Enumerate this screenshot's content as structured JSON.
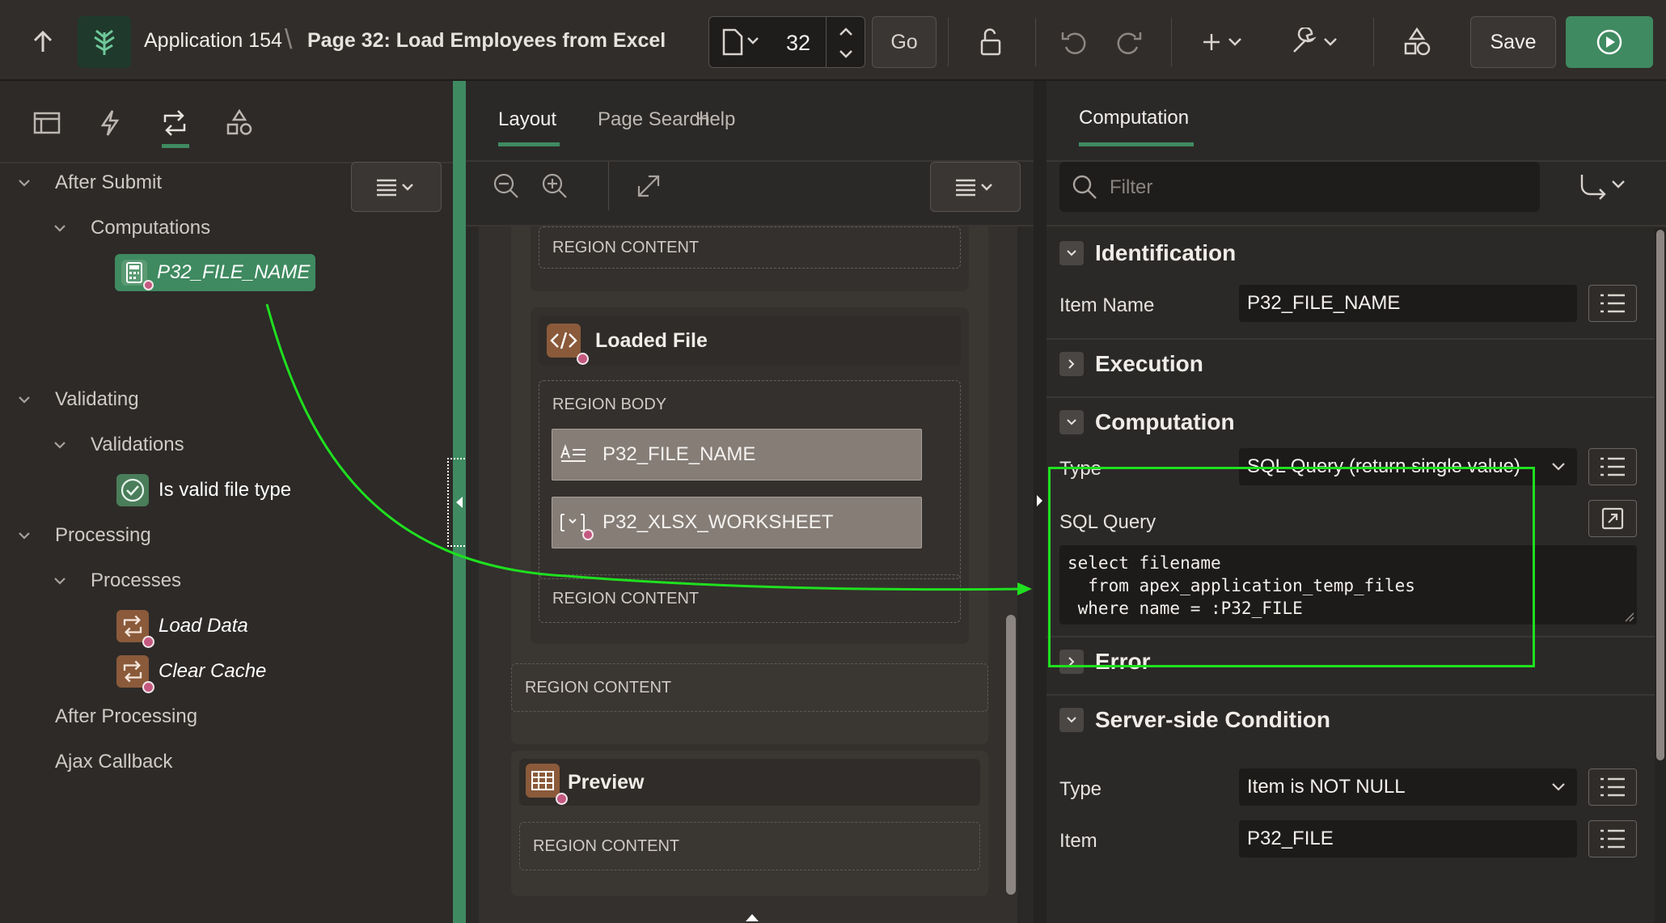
{
  "header": {
    "app_title": "Application 154",
    "page_title": "Page 32: Load Employees from Excel",
    "page_number": "32",
    "go_label": "Go",
    "save_label": "Save"
  },
  "left": {
    "tree": {
      "after_submit": "After Submit",
      "computations": "Computations",
      "computation_item": "P32_FILE_NAME",
      "validating": "Validating",
      "validations": "Validations",
      "validation_item": "Is valid file type",
      "processing": "Processing",
      "processes": "Processes",
      "process_load": "Load Data",
      "process_clear": "Clear Cache",
      "after_processing": "After Processing",
      "ajax_callback": "Ajax Callback"
    }
  },
  "center": {
    "tabs": [
      "Layout",
      "Page Search",
      "Help"
    ],
    "region_content": "REGION CONTENT",
    "region_body": "REGION BODY",
    "loaded_file": "Loaded File",
    "item_file_name": "P32_FILE_NAME",
    "item_worksheet": "P32_XLSX_WORKSHEET",
    "preview": "Preview"
  },
  "right": {
    "tab": "Computation",
    "filter_placeholder": "Filter",
    "sections": {
      "identification": "Identification",
      "execution": "Execution",
      "computation": "Computation",
      "error": "Error",
      "server_side": "Server-side Condition"
    },
    "fields": {
      "item_name_label": "Item Name",
      "item_name_value": "P32_FILE_NAME",
      "type_label": "Type",
      "type_value": "SQL Query (return single value)",
      "sql_label": "SQL Query",
      "sql_line1": "select filename",
      "sql_line2": "  from apex_application_temp_files",
      "sql_line3": " where name = :P32_FILE",
      "cond_type_label": "Type",
      "cond_type_value": "Item is NOT NULL",
      "cond_item_label": "Item",
      "cond_item_value": "P32_FILE"
    }
  },
  "colors": {
    "accent_green": "#3f8a60",
    "highlight_green": "#1fe01f",
    "badge_orange": "#8a5a3a"
  }
}
